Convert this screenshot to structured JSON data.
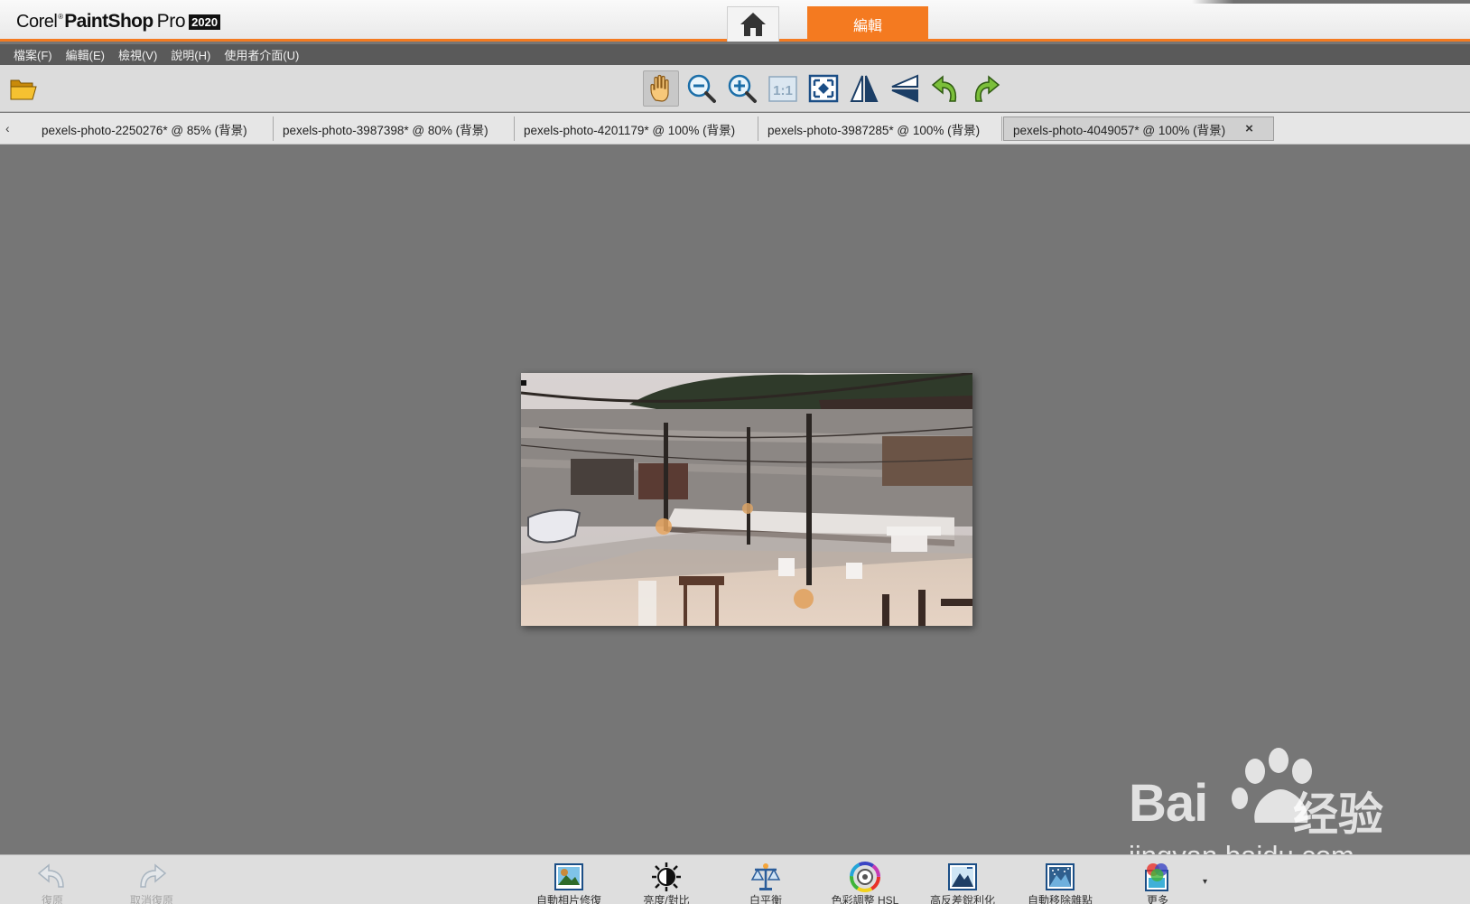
{
  "titlebar": {
    "logo_corel": "Corel",
    "logo_reg": "®",
    "logo_paintshop": "PaintShop",
    "logo_pro": "Pro",
    "logo_year": "2020",
    "home_icon": "home-icon",
    "edit_tab_label": "編輯"
  },
  "menu": {
    "items": [
      "檔案(F)",
      "編輯(E)",
      "檢視(V)",
      "說明(H)",
      "使用者介面(U)"
    ]
  },
  "toolbar": {
    "open_icon": "folder-open-icon",
    "tools": [
      {
        "name": "pan-tool",
        "icon": "hand-icon",
        "active": true
      },
      {
        "name": "zoom-out-tool",
        "icon": "zoom-out-icon"
      },
      {
        "name": "zoom-in-tool",
        "icon": "zoom-in-icon"
      },
      {
        "name": "actual-size-tool",
        "icon": "actual-size-icon",
        "label": "1:1"
      },
      {
        "name": "fit-window-tool",
        "icon": "fit-window-icon"
      },
      {
        "name": "flip-horizontal-tool",
        "icon": "flip-horizontal-icon"
      },
      {
        "name": "flip-vertical-tool",
        "icon": "flip-vertical-icon"
      },
      {
        "name": "rotate-left-tool",
        "icon": "rotate-left-icon"
      },
      {
        "name": "rotate-right-tool",
        "icon": "rotate-right-icon"
      }
    ]
  },
  "tabs": {
    "scroll_left": "‹",
    "items": [
      {
        "label": "pexels-photo-2250276* @  85% (背景)"
      },
      {
        "label": "pexels-photo-3987398* @  80% (背景)"
      },
      {
        "label": "pexels-photo-4201179* @ 100% (背景)"
      },
      {
        "label": "pexels-photo-3987285* @ 100% (背景)"
      },
      {
        "label": "pexels-photo-4049057* @ 100% (背景)",
        "active": true
      }
    ],
    "close": "×"
  },
  "bottombar": {
    "undo_label": "復原",
    "redo_label": "取消復原",
    "adjustments": [
      {
        "label": "自動相片修復",
        "icon": "smart-photo-fix-icon"
      },
      {
        "label": "亮度/對比",
        "icon": "brightness-contrast-icon"
      },
      {
        "label": "白平衡",
        "icon": "white-balance-icon"
      },
      {
        "label": "色彩調整 HSL",
        "icon": "hue-saturation-icon"
      },
      {
        "label": "高反差銳利化",
        "icon": "high-pass-sharpen-icon"
      },
      {
        "label": "自動移除雜點",
        "icon": "noise-removal-icon"
      },
      {
        "label": "更多",
        "icon": "more-adjustments-icon"
      }
    ],
    "dropdown": "▾"
  },
  "watermark": {
    "brand": "Bai",
    "brand2": "经验",
    "url": "jingyan.baidu.com"
  },
  "colors": {
    "accent": "#f47a20",
    "canvas": "#767676",
    "menubar": "#5a5a5a"
  }
}
